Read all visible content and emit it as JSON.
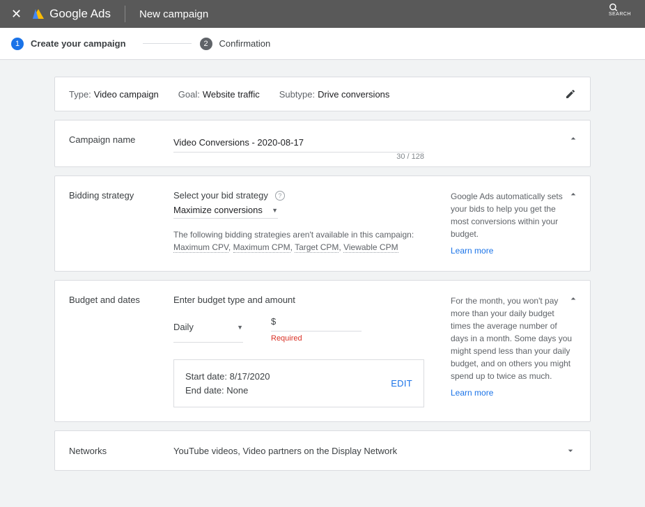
{
  "header": {
    "brand": "Google Ads",
    "page_title": "New campaign",
    "search_label": "SEARCH"
  },
  "steps": {
    "step1": {
      "num": "1",
      "label": "Create your campaign"
    },
    "step2": {
      "num": "2",
      "label": "Confirmation"
    }
  },
  "summary": {
    "type_label": "Type:",
    "type_value": "Video campaign",
    "goal_label": "Goal:",
    "goal_value": "Website traffic",
    "subtype_label": "Subtype:",
    "subtype_value": "Drive conversions"
  },
  "campaign_name": {
    "section": "Campaign name",
    "value": "Video Conversions - 2020-08-17",
    "counter": "30 / 128"
  },
  "bidding": {
    "section": "Bidding strategy",
    "select_label": "Select your bid strategy",
    "selected": "Maximize conversions",
    "unavailable_prefix": "The following bidding strategies aren't available in this campaign: ",
    "unavailable_1": "Maximum CPV",
    "unavailable_2": "Maximum CPM",
    "unavailable_3": "Target CPM",
    "unavailable_4": "Viewable CPM",
    "help_text": "Google Ads automatically sets your bids to help you get the most conversions within your budget.",
    "learn_more": "Learn more"
  },
  "budget": {
    "section": "Budget and dates",
    "prompt": "Enter budget type and amount",
    "type_value": "Daily",
    "amount_prefix": "$",
    "required": "Required",
    "start_date_label": "Start date: ",
    "start_date_value": "8/17/2020",
    "end_date_label": "End date: ",
    "end_date_value": "None",
    "edit": "EDIT",
    "help_text": "For the month, you won't pay more than your daily budget times the average number of days in a month. Some days you might spend less than your daily budget, and on others you might spend up to twice as much.",
    "learn_more": "Learn more"
  },
  "networks": {
    "section": "Networks",
    "value": "YouTube videos, Video partners on the Display Network"
  }
}
